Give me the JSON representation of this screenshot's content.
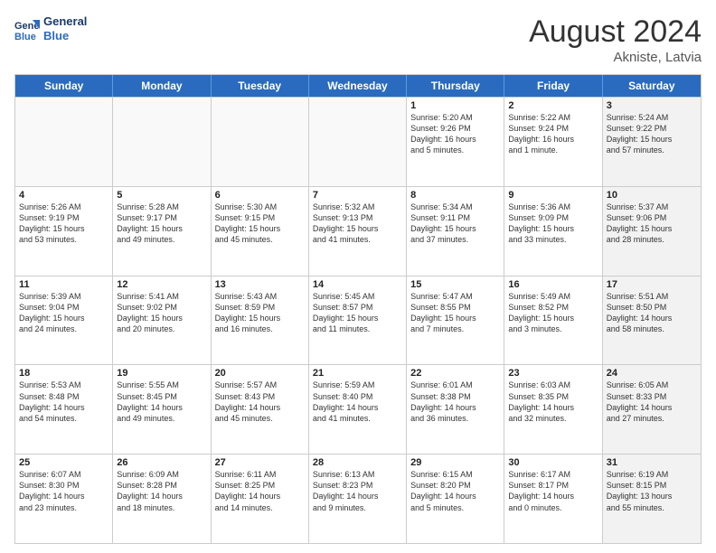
{
  "logo": {
    "line1": "General",
    "line2": "Blue"
  },
  "title": "August 2024",
  "location": "Akniste, Latvia",
  "days": [
    "Sunday",
    "Monday",
    "Tuesday",
    "Wednesday",
    "Thursday",
    "Friday",
    "Saturday"
  ],
  "rows": [
    [
      {
        "num": "",
        "text": "",
        "empty": true
      },
      {
        "num": "",
        "text": "",
        "empty": true
      },
      {
        "num": "",
        "text": "",
        "empty": true
      },
      {
        "num": "",
        "text": "",
        "empty": true
      },
      {
        "num": "1",
        "text": "Sunrise: 5:20 AM\nSunset: 9:26 PM\nDaylight: 16 hours\nand 5 minutes."
      },
      {
        "num": "2",
        "text": "Sunrise: 5:22 AM\nSunset: 9:24 PM\nDaylight: 16 hours\nand 1 minute."
      },
      {
        "num": "3",
        "text": "Sunrise: 5:24 AM\nSunset: 9:22 PM\nDaylight: 15 hours\nand 57 minutes.",
        "shaded": true
      }
    ],
    [
      {
        "num": "4",
        "text": "Sunrise: 5:26 AM\nSunset: 9:19 PM\nDaylight: 15 hours\nand 53 minutes."
      },
      {
        "num": "5",
        "text": "Sunrise: 5:28 AM\nSunset: 9:17 PM\nDaylight: 15 hours\nand 49 minutes."
      },
      {
        "num": "6",
        "text": "Sunrise: 5:30 AM\nSunset: 9:15 PM\nDaylight: 15 hours\nand 45 minutes."
      },
      {
        "num": "7",
        "text": "Sunrise: 5:32 AM\nSunset: 9:13 PM\nDaylight: 15 hours\nand 41 minutes."
      },
      {
        "num": "8",
        "text": "Sunrise: 5:34 AM\nSunset: 9:11 PM\nDaylight: 15 hours\nand 37 minutes."
      },
      {
        "num": "9",
        "text": "Sunrise: 5:36 AM\nSunset: 9:09 PM\nDaylight: 15 hours\nand 33 minutes."
      },
      {
        "num": "10",
        "text": "Sunrise: 5:37 AM\nSunset: 9:06 PM\nDaylight: 15 hours\nand 28 minutes.",
        "shaded": true
      }
    ],
    [
      {
        "num": "11",
        "text": "Sunrise: 5:39 AM\nSunset: 9:04 PM\nDaylight: 15 hours\nand 24 minutes."
      },
      {
        "num": "12",
        "text": "Sunrise: 5:41 AM\nSunset: 9:02 PM\nDaylight: 15 hours\nand 20 minutes."
      },
      {
        "num": "13",
        "text": "Sunrise: 5:43 AM\nSunset: 8:59 PM\nDaylight: 15 hours\nand 16 minutes."
      },
      {
        "num": "14",
        "text": "Sunrise: 5:45 AM\nSunset: 8:57 PM\nDaylight: 15 hours\nand 11 minutes."
      },
      {
        "num": "15",
        "text": "Sunrise: 5:47 AM\nSunset: 8:55 PM\nDaylight: 15 hours\nand 7 minutes."
      },
      {
        "num": "16",
        "text": "Sunrise: 5:49 AM\nSunset: 8:52 PM\nDaylight: 15 hours\nand 3 minutes."
      },
      {
        "num": "17",
        "text": "Sunrise: 5:51 AM\nSunset: 8:50 PM\nDaylight: 14 hours\nand 58 minutes.",
        "shaded": true
      }
    ],
    [
      {
        "num": "18",
        "text": "Sunrise: 5:53 AM\nSunset: 8:48 PM\nDaylight: 14 hours\nand 54 minutes."
      },
      {
        "num": "19",
        "text": "Sunrise: 5:55 AM\nSunset: 8:45 PM\nDaylight: 14 hours\nand 49 minutes."
      },
      {
        "num": "20",
        "text": "Sunrise: 5:57 AM\nSunset: 8:43 PM\nDaylight: 14 hours\nand 45 minutes."
      },
      {
        "num": "21",
        "text": "Sunrise: 5:59 AM\nSunset: 8:40 PM\nDaylight: 14 hours\nand 41 minutes."
      },
      {
        "num": "22",
        "text": "Sunrise: 6:01 AM\nSunset: 8:38 PM\nDaylight: 14 hours\nand 36 minutes."
      },
      {
        "num": "23",
        "text": "Sunrise: 6:03 AM\nSunset: 8:35 PM\nDaylight: 14 hours\nand 32 minutes."
      },
      {
        "num": "24",
        "text": "Sunrise: 6:05 AM\nSunset: 8:33 PM\nDaylight: 14 hours\nand 27 minutes.",
        "shaded": true
      }
    ],
    [
      {
        "num": "25",
        "text": "Sunrise: 6:07 AM\nSunset: 8:30 PM\nDaylight: 14 hours\nand 23 minutes."
      },
      {
        "num": "26",
        "text": "Sunrise: 6:09 AM\nSunset: 8:28 PM\nDaylight: 14 hours\nand 18 minutes."
      },
      {
        "num": "27",
        "text": "Sunrise: 6:11 AM\nSunset: 8:25 PM\nDaylight: 14 hours\nand 14 minutes."
      },
      {
        "num": "28",
        "text": "Sunrise: 6:13 AM\nSunset: 8:23 PM\nDaylight: 14 hours\nand 9 minutes."
      },
      {
        "num": "29",
        "text": "Sunrise: 6:15 AM\nSunset: 8:20 PM\nDaylight: 14 hours\nand 5 minutes."
      },
      {
        "num": "30",
        "text": "Sunrise: 6:17 AM\nSunset: 8:17 PM\nDaylight: 14 hours\nand 0 minutes."
      },
      {
        "num": "31",
        "text": "Sunrise: 6:19 AM\nSunset: 8:15 PM\nDaylight: 13 hours\nand 55 minutes.",
        "shaded": true
      }
    ]
  ]
}
